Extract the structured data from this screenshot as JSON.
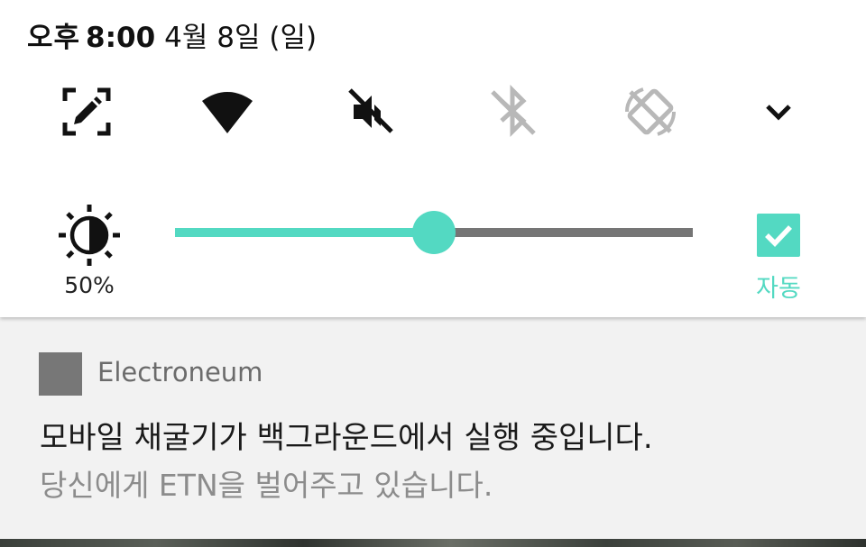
{
  "status_bar": {
    "ampm": "오후",
    "time": "8:00",
    "date": "4월 8일 (일)"
  },
  "quick_settings": {
    "tiles": [
      "screen-capture-icon",
      "wifi-icon",
      "sound-muted-icon",
      "bluetooth-off-icon",
      "auto-rotate-off-icon"
    ],
    "expand_icon": "chevron-down-icon"
  },
  "brightness": {
    "icon": "brightness-icon",
    "percent_label": "50%",
    "level": 0.5,
    "auto_label": "자동",
    "auto_checked": true
  },
  "notification": {
    "app_name": "Electroneum",
    "title": "모바일 채굴기가 백그라운드에서 실행 중입니다.",
    "text": "당신에게 ETN을 벌어주고 있습니다."
  },
  "colors": {
    "accent": "#53d9c2",
    "track": "#757575",
    "disabled_icon": "#b8b8b8",
    "notification_bg": "#f2f2f2"
  }
}
